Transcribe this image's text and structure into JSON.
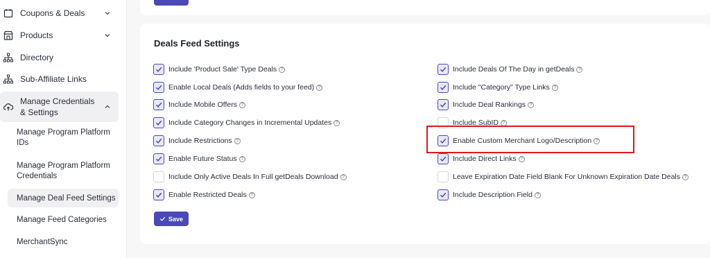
{
  "sidebar": {
    "items": [
      {
        "label": "Coupons & Deals",
        "icon": "calendar-icon",
        "has_chevron": true
      },
      {
        "label": "Products",
        "icon": "store-icon",
        "has_chevron": true
      },
      {
        "label": "Directory",
        "icon": "sitemap-icon",
        "has_chevron": false
      },
      {
        "label": "Sub-Affiliate Links",
        "icon": "sitemap-icon",
        "has_chevron": false
      },
      {
        "label": "Manage Credentials & Settings",
        "icon": "cloud-upload-icon",
        "has_chevron": true
      }
    ],
    "sub_items": [
      "Manage Program Platform IDs",
      "Manage Program Platform Credentials",
      "Manage Deal Feed Settings",
      "Manage Feed Categories",
      "MerchantSync"
    ],
    "selected_sub_item": "Manage Deal Feed Settings"
  },
  "card": {
    "title": "Deals Feed Settings",
    "save_label": "Save",
    "help_glyph": "?",
    "left_options": [
      {
        "label": "Include 'Product Sale' Type Deals",
        "checked": true
      },
      {
        "label": "Enable Local Deals (Adds fields to your feed)",
        "checked": true
      },
      {
        "label": "Include Mobile Offers",
        "checked": true
      },
      {
        "label": "Include Category Changes in Incremental Updates",
        "checked": true
      },
      {
        "label": "Include Restrictions",
        "checked": true
      },
      {
        "label": "Enable Future Status",
        "checked": true
      },
      {
        "label": "Include Only Active Deals In Full getDeals Download",
        "checked": false
      },
      {
        "label": "Enable Restricted Deals",
        "checked": true
      }
    ],
    "right_options": [
      {
        "label": "Include Deals Of The Day in getDeals",
        "checked": true
      },
      {
        "label": "Include \"Category\" Type Links",
        "checked": true
      },
      {
        "label": "Include Deal Rankings",
        "checked": true
      },
      {
        "label": "Include SubID",
        "checked": false
      },
      {
        "label": "Enable Custom Merchant Logo/Description",
        "checked": true
      },
      {
        "label": "Include Direct Links",
        "checked": true
      },
      {
        "label": "Leave Expiration Date Field Blank For Unknown Expiration Date Deals",
        "checked": false
      },
      {
        "label": "Include Description Field",
        "checked": true
      }
    ]
  },
  "colors": {
    "accent": "#4b49b8",
    "highlight": "#e3151a"
  }
}
